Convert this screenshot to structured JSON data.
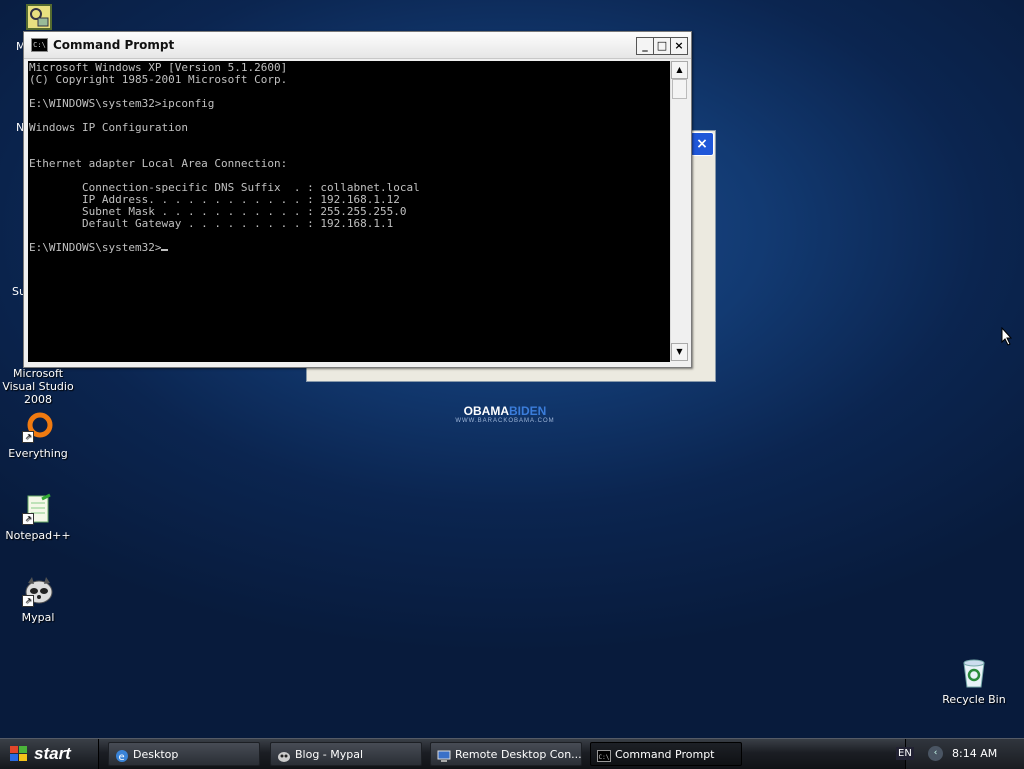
{
  "desktop": {
    "icons": [
      {
        "label": "M",
        "name": "unknown"
      },
      {
        "label": "Microsoft Visual Studio 2008",
        "name": "visual-studio"
      },
      {
        "label": "Everything",
        "name": "everything"
      },
      {
        "label": "Notepad++",
        "name": "notepad-plus-plus"
      },
      {
        "label": "Mypal",
        "name": "mypal"
      },
      {
        "label": "Recycle Bin",
        "name": "recycle-bin"
      }
    ],
    "partial_labels": {
      "m1": "M",
      "m2": "N",
      "su": "Su"
    },
    "wallpaper_logo": {
      "line1_a": "OBAMA",
      "line1_b": "BIDEN",
      "line2": "WWW.BARACKOBAMA.COM"
    }
  },
  "cmd_window": {
    "title": "Command Prompt",
    "minimize": "_",
    "maximize": "□",
    "close": "×",
    "console_lines": [
      "Microsoft Windows XP [Version 5.1.2600]",
      "(C) Copyright 1985-2001 Microsoft Corp.",
      "",
      "E:\\WINDOWS\\system32>ipconfig",
      "",
      "Windows IP Configuration",
      "",
      "",
      "Ethernet adapter Local Area Connection:",
      "",
      "        Connection-specific DNS Suffix  . : collabnet.local",
      "        IP Address. . . . . . . . . . . . : 192.168.1.12",
      "        Subnet Mask . . . . . . . . . . . : 255.255.255.0",
      "        Default Gateway . . . . . . . . . : 192.168.1.1",
      "",
      "E:\\WINDOWS\\system32>"
    ]
  },
  "taskbar": {
    "start_label": "start",
    "items": [
      {
        "label": "Desktop",
        "active": false
      },
      {
        "label": "Blog - Mypal",
        "active": false
      },
      {
        "label": "Remote Desktop Con...",
        "active": false
      },
      {
        "label": "Command Prompt",
        "active": true
      }
    ],
    "language": "EN",
    "clock": "8:14 AM"
  },
  "colors": {
    "console_bg": "#000000",
    "console_fg": "#c0c0c0",
    "taskbar": "#1b1e24",
    "desktop": "#123a72"
  }
}
